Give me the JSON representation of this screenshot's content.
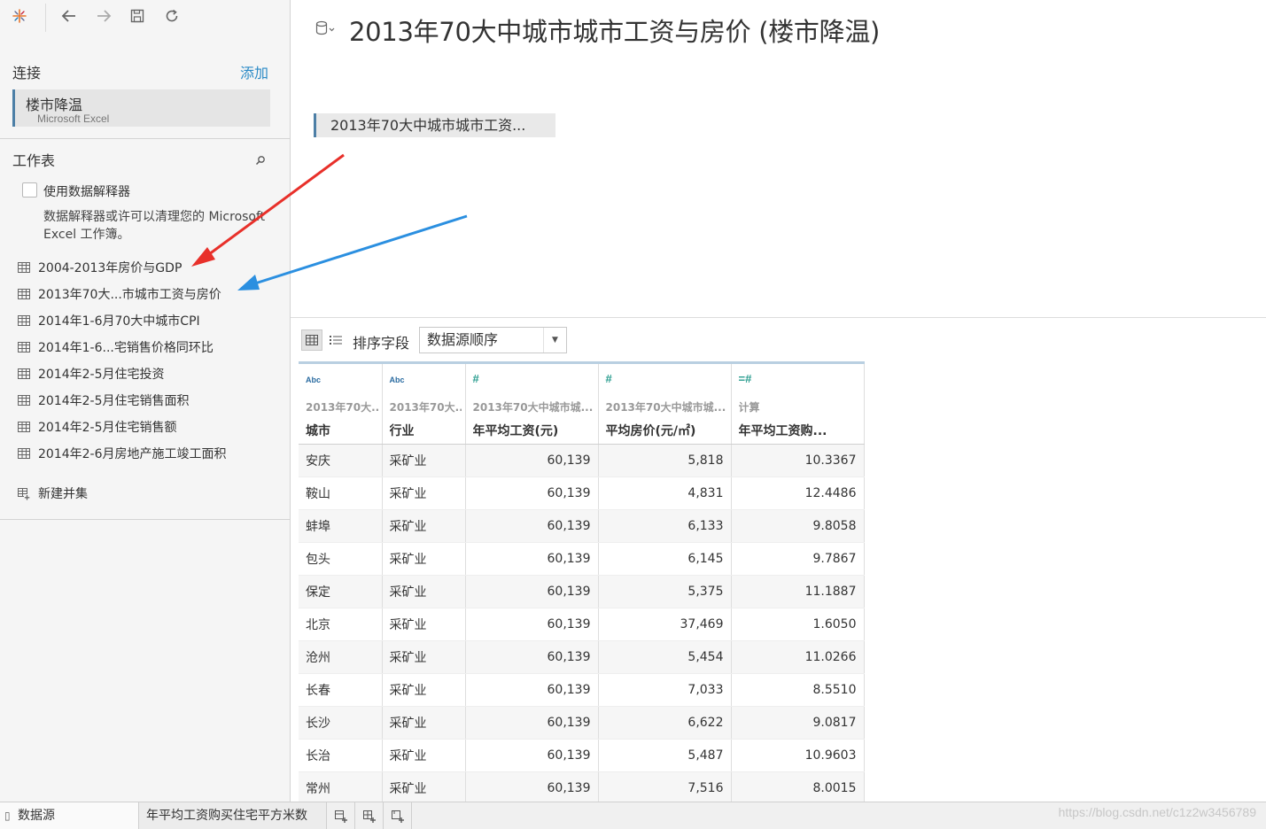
{
  "toolbar": {
    "logo": "tableau-logo-icon",
    "back": "back-arrow-icon",
    "forward": "forward-arrow-icon",
    "save": "save-icon",
    "refresh": "refresh-icon"
  },
  "sidebar": {
    "connections_label": "连接",
    "add_label": "添加",
    "connection": {
      "name": "楼市降温",
      "type": "Microsoft Excel"
    },
    "sheets_label": "工作表",
    "interpreter_label": "使用数据解释器",
    "interpreter_hint": "数据解释器或许可以清理您的 Microsoft Excel 工作簿。",
    "sheets": [
      "2004-2013年房价与GDP",
      "2013年70大...市城市工资与房价",
      "2014年1-6月70大中城市CPI",
      "2014年1-6...宅销售价格同环比",
      "2014年2-5月住宅投资",
      "2014年2-5月住宅销售面积",
      "2014年2-5月住宅销售额",
      "2014年2-6月房地产施工竣工面积"
    ],
    "new_union_label": "新建并集"
  },
  "main": {
    "title": "2013年70大中城市城市工资与房价 (楼市降温)",
    "canvas_table": "2013年70大中城市城市工资...",
    "sort_label": "排序字段",
    "sort_value": "数据源顺序"
  },
  "table": {
    "columns": [
      {
        "type": "Abc",
        "source": "2013年70大...",
        "name": "城市"
      },
      {
        "type": "Abc",
        "source": "2013年70大...",
        "name": "行业"
      },
      {
        "type": "#",
        "source": "2013年70大中城市城...",
        "name": "年平均工资(元)"
      },
      {
        "type": "#",
        "source": "2013年70大中城市城...",
        "name": "平均房价(元/㎡)"
      },
      {
        "type": "=#",
        "source": "计算",
        "name": "年平均工资购..."
      }
    ],
    "rows": [
      [
        "安庆",
        "采矿业",
        "60,139",
        "5,818",
        "10.3367"
      ],
      [
        "鞍山",
        "采矿业",
        "60,139",
        "4,831",
        "12.4486"
      ],
      [
        "蚌埠",
        "采矿业",
        "60,139",
        "6,133",
        "9.8058"
      ],
      [
        "包头",
        "采矿业",
        "60,139",
        "6,145",
        "9.7867"
      ],
      [
        "保定",
        "采矿业",
        "60,139",
        "5,375",
        "11.1887"
      ],
      [
        "北京",
        "采矿业",
        "60,139",
        "37,469",
        "1.6050"
      ],
      [
        "沧州",
        "采矿业",
        "60,139",
        "5,454",
        "11.0266"
      ],
      [
        "长春",
        "采矿业",
        "60,139",
        "7,033",
        "8.5510"
      ],
      [
        "长沙",
        "采矿业",
        "60,139",
        "6,622",
        "9.0817"
      ],
      [
        "长治",
        "采矿业",
        "60,139",
        "5,487",
        "10.9603"
      ],
      [
        "常州",
        "采矿业",
        "60,139",
        "7,516",
        "8.0015"
      ]
    ]
  },
  "bottom": {
    "datasource_tab": "数据源",
    "sheet_tab": "年平均工资购买住宅平方米数",
    "watermark": "https://blog.csdn.net/c1z2w3456789"
  },
  "annotations": {
    "red_arrow_color": "#e8302a",
    "blue_arrow_color": "#2b8fe0"
  }
}
